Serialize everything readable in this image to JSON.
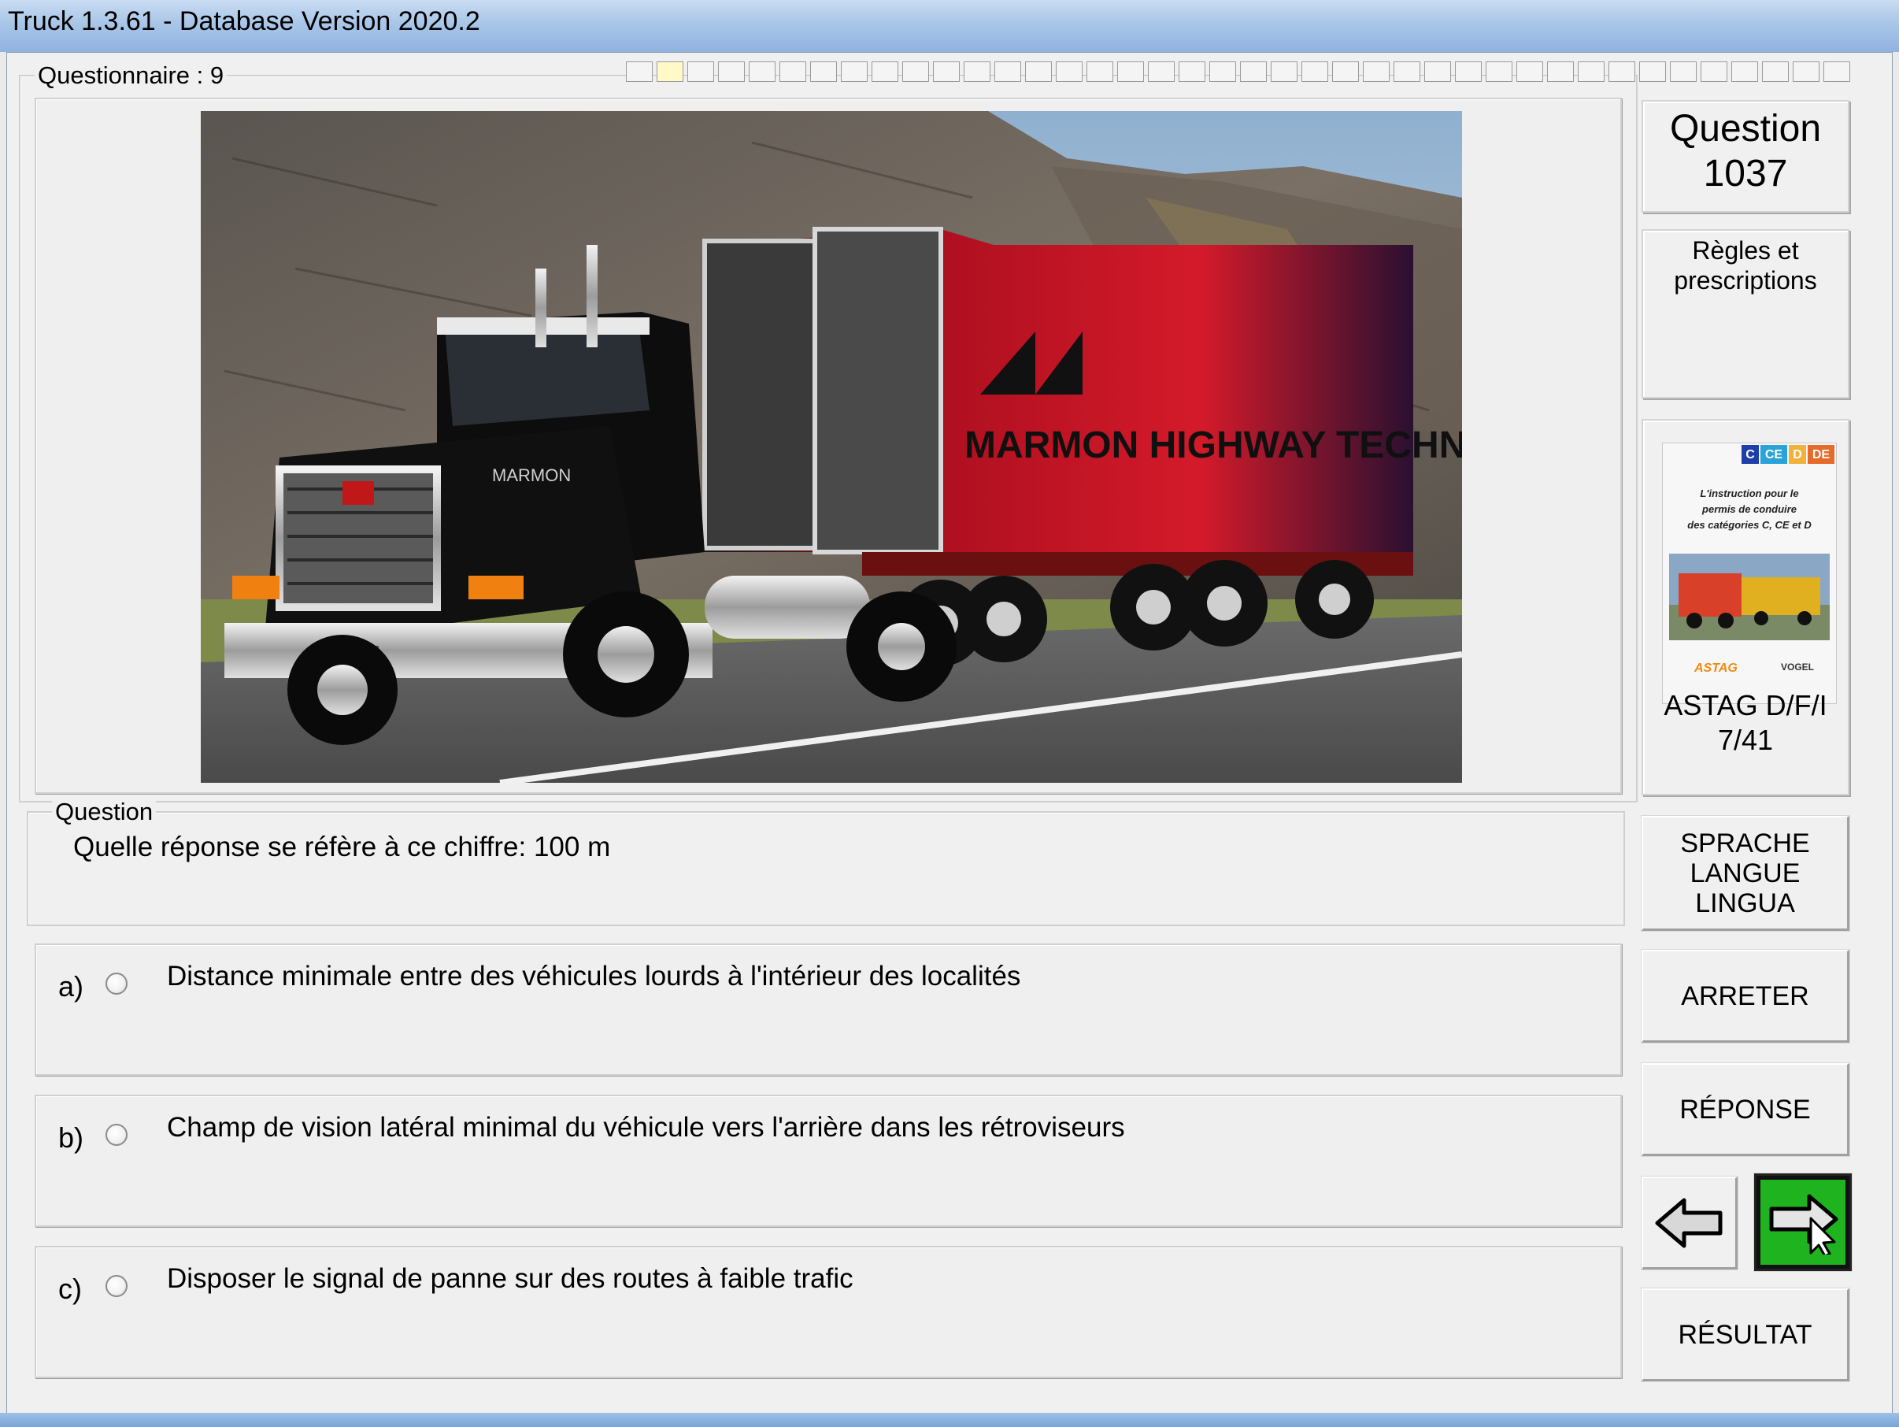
{
  "window": {
    "title": "Truck 1.3.61 - Database Version 2020.2"
  },
  "questionnaire": {
    "label": "Questionnaire : 9",
    "segments_total": 40,
    "current_segment": 1
  },
  "question_panel": {
    "label": "Question",
    "text": "Quelle réponse se réfère à ce chiffre: 100 m"
  },
  "answers": [
    {
      "letter": "a)",
      "text": "Distance minimale entre des véhicules lourds à l'intérieur des localités",
      "selected": false
    },
    {
      "letter": "b)",
      "text": "Champ de vision latéral minimal du véhicule vers l'arrière dans les rétroviseurs",
      "selected": false
    },
    {
      "letter": "c)",
      "text": "Disposer le signal de panne sur des routes à faible trafic",
      "selected": false
    }
  ],
  "sidebar": {
    "question_title": "Question",
    "question_number": "1037",
    "category_line1": "Règles et",
    "category_line2": "prescriptions",
    "book": {
      "tags": [
        "C",
        "CE",
        "D",
        "DE"
      ],
      "title_lines": [
        "L'instruction pour le",
        "permis de conduire",
        "des catégories C, CE et D"
      ],
      "source_line1": "ASTAG D/F/I",
      "source_line2": "7/41"
    },
    "language_line1": "SPRACHE",
    "language_line2": "LANGUE",
    "language_line3": "LINGUA",
    "stop_label": "ARRETER",
    "answer_label": "RÉPONSE",
    "result_label": "RÉSULTAT"
  },
  "photo": {
    "trailer_brand": "MARMON HIGHWAY TECHNOLOGIES",
    "cab_brand": "MARMON"
  },
  "colors": {
    "next_button": "#1fb31f",
    "title_bar": "#a9c6e8"
  }
}
